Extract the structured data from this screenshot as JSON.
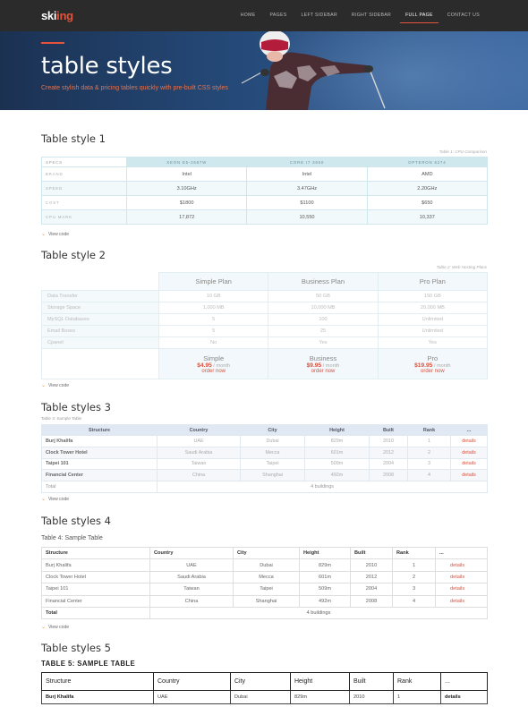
{
  "nav": {
    "logo_prefix": "ski",
    "logo_accent": "ing",
    "items": [
      "HOME",
      "PAGES",
      "LEFT SIDEBAR",
      "RIGHT SIDEBAR",
      "FULL PAGE",
      "CONTACT US"
    ],
    "active_index": 4
  },
  "hero": {
    "title": "table styles",
    "subtitle": "Create stylish data & pricing tables quickly with pre-built CSS styles"
  },
  "colors": {
    "accent": "#e5533d",
    "nav_bg": "#2b2b2b"
  },
  "view_code": "View code",
  "table1": {
    "title": "Table style 1",
    "caption": "Table 1: CPU Comparison",
    "headers": [
      "SPECS",
      "XEON E5-2687W",
      "CORE I7 3960",
      "OPTERON 6274"
    ],
    "rows": [
      [
        "BRAND",
        "Intel",
        "Intel",
        "AMD"
      ],
      [
        "SPEED",
        "3.10GHz",
        "3.47GHz",
        "2.20GHz"
      ],
      [
        "COST",
        "$1800",
        "$1100",
        "$650"
      ],
      [
        "CPU MARK",
        "17,872",
        "10,550",
        "10,337"
      ]
    ]
  },
  "table2": {
    "title": "Table style 2",
    "caption": "Table 2: Web Hosting Plans",
    "headers": [
      "Simple Plan",
      "Business Plan",
      "Pro Plan"
    ],
    "rows": [
      [
        "Data Transfer",
        "10 GB",
        "50 GB",
        "150 GB"
      ],
      [
        "Storage Space",
        "1,000 MB",
        "10,000 MB",
        "20,000 MB"
      ],
      [
        "MySQL Databases",
        "5",
        "100",
        "Unlimited"
      ],
      [
        "Email Boxes",
        "5",
        "25",
        "Unlimited"
      ],
      [
        "Cpanel",
        "No",
        "Yes",
        "Yes"
      ]
    ],
    "plans": [
      {
        "name": "Simple",
        "price": "$4.95",
        "period": " / month",
        "cta": "order now"
      },
      {
        "name": "Business",
        "price": "$9.95",
        "period": " / month",
        "cta": "order now"
      },
      {
        "name": "Pro",
        "price": "$19.95",
        "period": " / month",
        "cta": "order now"
      }
    ]
  },
  "table3": {
    "title": "Table styles 3",
    "caption": "Table 3: Sample Table",
    "headers": [
      "Structure",
      "Country",
      "City",
      "Height",
      "Built",
      "Rank",
      "..."
    ],
    "rows": [
      [
        "Burj Khalifa",
        "UAE",
        "Dubai",
        "829m",
        "2010",
        "1",
        "details"
      ],
      [
        "Clock Tower Hotel",
        "Saudi Arabia",
        "Mecca",
        "601m",
        "2012",
        "2",
        "details"
      ],
      [
        "Taipei 101",
        "Taiwan",
        "Taipei",
        "509m",
        "2004",
        "3",
        "details"
      ],
      [
        "Financial Center",
        "China",
        "Shanghai",
        "492m",
        "2008",
        "4",
        "details"
      ]
    ],
    "total_label": "Total",
    "total_value": "4 buildings"
  },
  "table4": {
    "title": "Table styles 4",
    "caption": "Table 4: Sample Table",
    "headers": [
      "Structure",
      "Country",
      "City",
      "Height",
      "Built",
      "Rank",
      "..."
    ],
    "rows": [
      [
        "Burj Khalifa",
        "UAE",
        "Dubai",
        "829m",
        "2010",
        "1",
        "details"
      ],
      [
        "Clock Tower Hotel",
        "Saudi Arabia",
        "Mecca",
        "601m",
        "2012",
        "2",
        "details"
      ],
      [
        "Taipei 101",
        "Taiwan",
        "Taipei",
        "509m",
        "2004",
        "3",
        "details"
      ],
      [
        "Financial Center",
        "China",
        "Shanghai",
        "492m",
        "2008",
        "4",
        "details"
      ]
    ],
    "total_label": "Total",
    "total_value": "4 buildings"
  },
  "table5": {
    "title": "Table styles 5",
    "caption": "TABLE 5: SAMPLE TABLE",
    "headers": [
      "Structure",
      "Country",
      "City",
      "Height",
      "Built",
      "Rank",
      "..."
    ],
    "rows": [
      [
        "Burj Khalifa",
        "UAE",
        "Dubai",
        "829m",
        "2010",
        "1",
        "details"
      ]
    ]
  }
}
